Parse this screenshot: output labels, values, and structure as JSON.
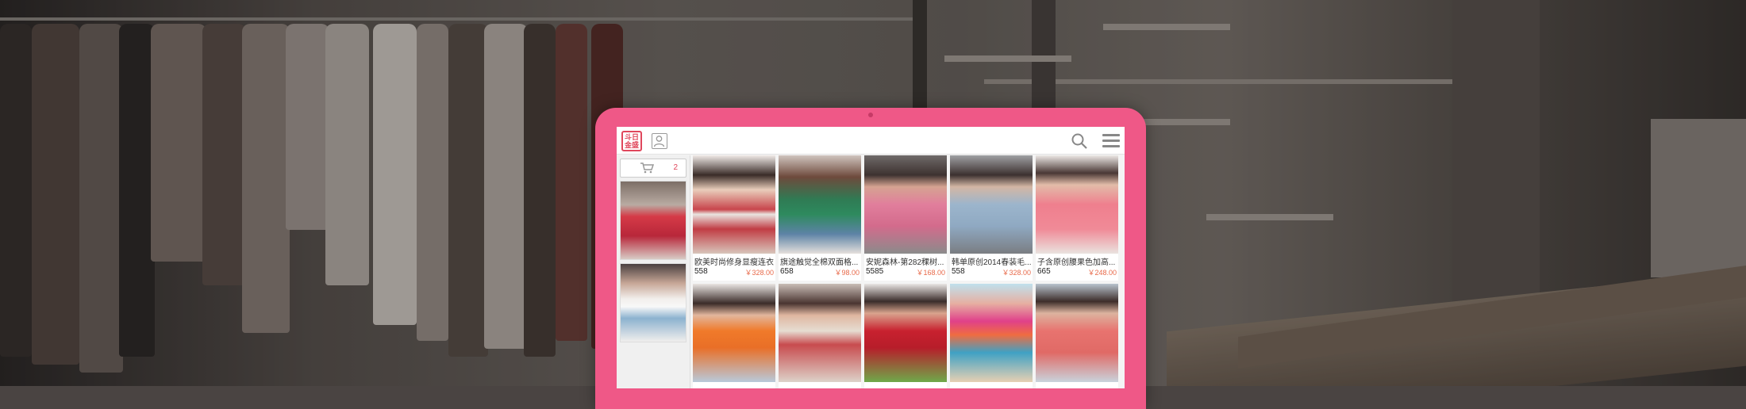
{
  "header": {
    "logo_text": "斗日金盛"
  },
  "cart": {
    "count": "2"
  },
  "products": [
    {
      "title": "欧美时尚修身显瘦连衣裙",
      "sales": "558",
      "price": "￥328.00"
    },
    {
      "title": "旗途触觉全棉双面格...",
      "sales": "658",
      "price": "￥98.00"
    },
    {
      "title": "安妮森林-第282稞树...",
      "sales": "5585",
      "price": "￥168.00"
    },
    {
      "title": "韩单原创2014春装毛...",
      "sales": "558",
      "price": "￥328.00"
    },
    {
      "title": "子含原创腰果色加高...",
      "sales": "665",
      "price": "￥248.00"
    }
  ],
  "colors": {
    "tablet_frame": "#ef5887",
    "accent": "#e0475c",
    "price": "#e86a4a"
  }
}
